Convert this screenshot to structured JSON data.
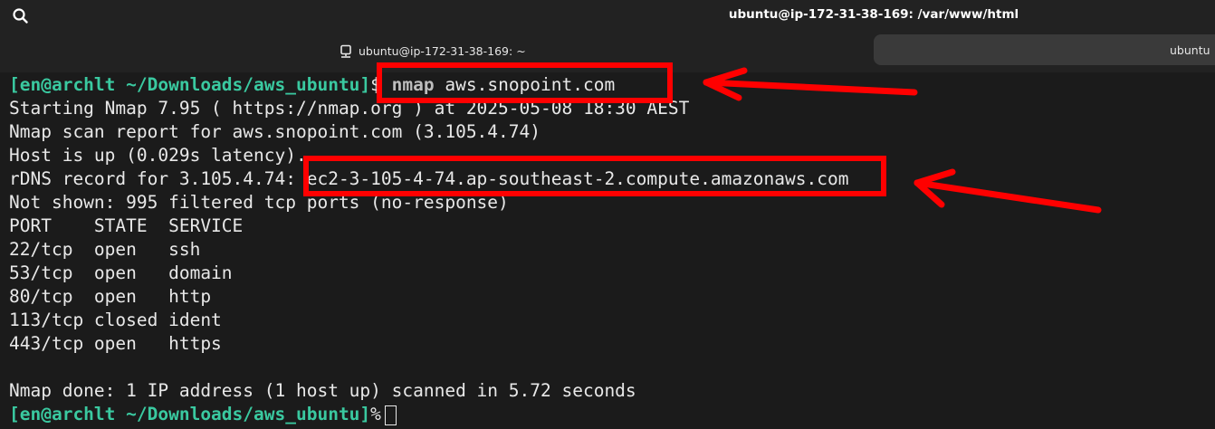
{
  "header": {
    "window_title": "ubuntu@ip-172-31-38-169: /var/www/html"
  },
  "tabs": [
    {
      "label": "ubuntu@ip-172-31-38-169: ~",
      "active": true,
      "icon": "terminal-tab-icon"
    },
    {
      "label": "ubuntu",
      "active": false
    }
  ],
  "terminal": {
    "prompt": "[en@archlt ~/Downloads/aws_ubuntu]",
    "prompt_symbol": "$",
    "command_name": "nmap",
    "command_arg": "aws.snopoint.com",
    "output": [
      "Starting Nmap 7.95 ( https://nmap.org ) at 2025-05-08 18:30 AEST",
      "Nmap scan report for aws.snopoint.com (3.105.4.74)",
      "Host is up (0.029s latency).",
      "rDNS record for 3.105.4.74: ec2-3-105-4-74.ap-southeast-2.compute.amazonaws.com",
      "Not shown: 995 filtered tcp ports (no-response)",
      "PORT    STATE  SERVICE",
      "22/tcp  open   ssh",
      "53/tcp  open   domain",
      "80/tcp  open   http",
      "113/tcp closed ident",
      "443/tcp open   https",
      "",
      "Nmap done: 1 IP address (1 host up) scanned in 5.72 seconds"
    ],
    "final_prompt": "[en@archlt ~/Downloads/aws_ubuntu]",
    "final_prompt_symbol": "%"
  },
  "colors": {
    "background": "#1b1b1b",
    "prompt": "#3ac9a0",
    "text": "#e8e8e8",
    "annotation": "#ff0000"
  },
  "icons": [
    "search-icon",
    "terminal-tab-icon",
    "cursor"
  ]
}
